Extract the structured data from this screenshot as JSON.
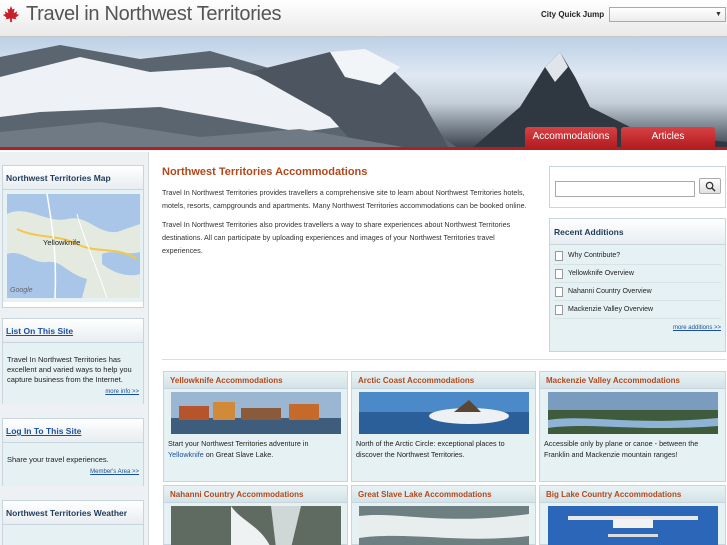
{
  "header": {
    "site_title": "Travel in Northwest Territories",
    "quick_jump_label": "City Quick Jump",
    "quick_jump_value": ""
  },
  "nav": {
    "tabs": [
      {
        "label": "Accommodations"
      },
      {
        "label": "Articles"
      }
    ]
  },
  "sidebar": {
    "map_box": {
      "title": "Northwest Territories Map",
      "map_label": "Yellowknife",
      "map_credit": "Google"
    },
    "list_box": {
      "title": "List On This Site",
      "text": "Travel In Northwest Territories has excellent and varied ways to help you capture business from the Internet.",
      "more": "more info >>"
    },
    "login_box": {
      "title": "Log In To This Site",
      "text": "Share your travel experiences.",
      "more": "Member's Area >>"
    },
    "weather_box": {
      "title": "Northwest Territories Weather"
    }
  },
  "main": {
    "title": "Northwest Territories Accommodations",
    "para1": "Travel In Northwest Territories provides travellers a comprehensive site to learn about Northwest Territories hotels, motels, resorts, campgrounds and apartments. Many Northwest Territories accommodations can be booked online.",
    "para2": "Travel In Northwest Territories also provides travellers a way to share experiences about Northwest Territories destinations. All can participate by uploading experiences and images of your Northwest Territories travel experiences."
  },
  "search": {
    "placeholder": "",
    "button_icon": "magnifier-icon"
  },
  "recent": {
    "title": "Recent Additions",
    "items": [
      "Why Contribute?",
      "Yellowknife Overview",
      "Nahanni Country Overview",
      "Mackenzie Valley Overview"
    ],
    "more": "more additions >>"
  },
  "cards": [
    {
      "title": "Yellowknife Accommodations",
      "text_before": "Start your Northwest Territories adventure in ",
      "link": "Yellowknife",
      "text_after": " on Great Slave Lake."
    },
    {
      "title": "Arctic Coast Accommodations",
      "text_before": "North of the Arctic Circle: exceptional places to discover the Northwest Territories.",
      "link": "",
      "text_after": ""
    },
    {
      "title": "Mackenzie Valley Accommodations",
      "text_before": "Accessible only by plane or canoe - between the Franklin and Mackenzie mountain ranges!",
      "link": "",
      "text_after": ""
    },
    {
      "title": "Nahanni Country Accommodations",
      "text_before": "",
      "link": "",
      "text_after": ""
    },
    {
      "title": "Great Slave Lake Accommodations",
      "text_before": "",
      "link": "",
      "text_after": ""
    },
    {
      "title": "Big Lake Country Accommodations",
      "text_before": "",
      "link": "",
      "text_after": ""
    }
  ],
  "colors": {
    "accent_red": "#b01f24",
    "heading_orange": "#b3481b",
    "panel_blue": "#e6f1f3"
  }
}
